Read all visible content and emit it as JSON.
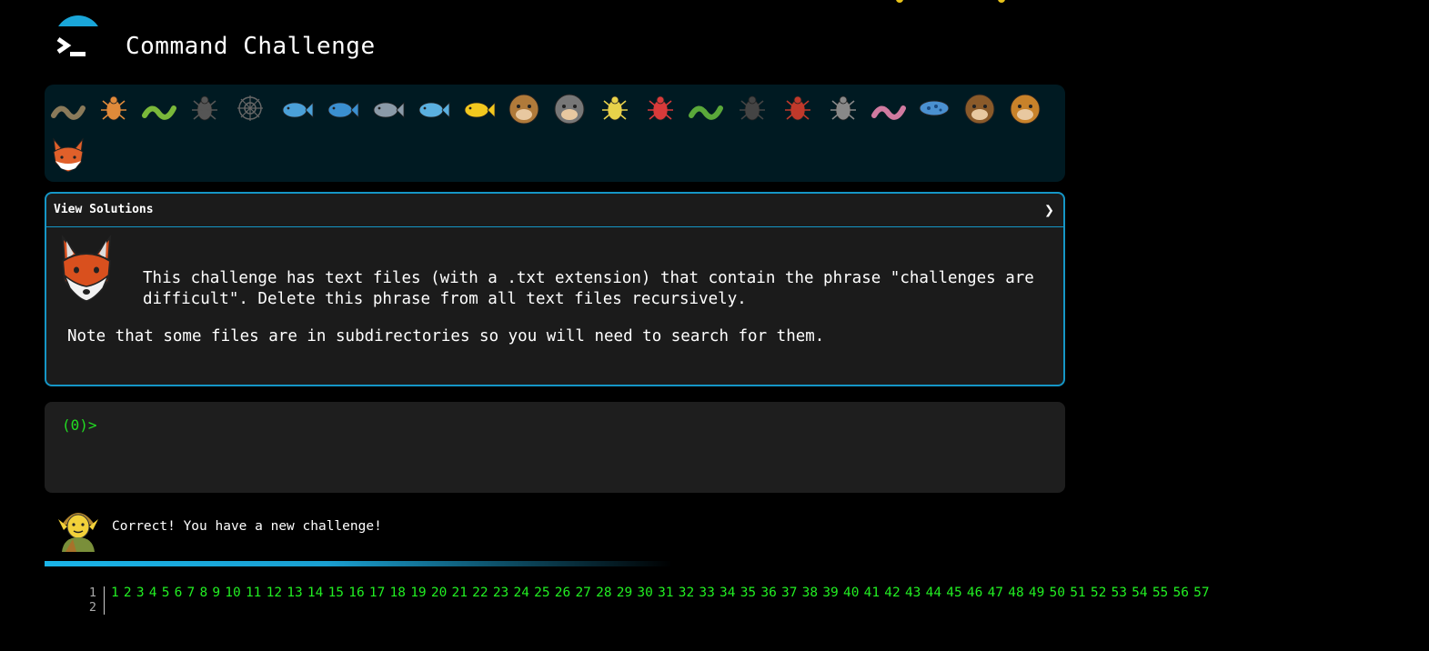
{
  "header": {
    "title": "Command Challenge",
    "logo_icon": "terminal-prompt-icon",
    "accent_color": "#1aa6d9"
  },
  "animals": [
    {
      "name": "snail-icon"
    },
    {
      "name": "butterfly-icon"
    },
    {
      "name": "caterpillar-icon"
    },
    {
      "name": "ant-icon"
    },
    {
      "name": "spider-web-icon"
    },
    {
      "name": "whale-icon"
    },
    {
      "name": "dolphin-icon"
    },
    {
      "name": "shark-icon"
    },
    {
      "name": "fish-icon"
    },
    {
      "name": "tropical-fish-icon"
    },
    {
      "name": "blowfish-icon"
    },
    {
      "name": "wolf-icon"
    },
    {
      "name": "bee-icon"
    },
    {
      "name": "ladybug-icon"
    },
    {
      "name": "cricket-icon"
    },
    {
      "name": "spider-icon"
    },
    {
      "name": "scorpion-icon"
    },
    {
      "name": "fly-icon"
    },
    {
      "name": "worm-icon"
    },
    {
      "name": "microbe-icon"
    },
    {
      "name": "monkey-icon"
    },
    {
      "name": "dog-icon"
    },
    {
      "name": "fox-icon"
    }
  ],
  "challenge": {
    "view_solutions": "View Solutions",
    "chevron": "❯",
    "description": "This challenge has text files (with a .txt extension) that contain the phrase \"challenges are difficult\". Delete this phrase from all text files recursively.",
    "note": "Note that some files are in subdirectories so you will need to search for them."
  },
  "terminal": {
    "prompt": "(0)>",
    "input_value": "",
    "prompt_color": "#22dd22"
  },
  "feedback": {
    "message": "Correct! You have a new challenge!"
  },
  "editor": {
    "line_numbers": [
      "1",
      "2"
    ],
    "levels": [
      "1",
      "2",
      "3",
      "4",
      "5",
      "6",
      "7",
      "8",
      "9",
      "10",
      "11",
      "12",
      "13",
      "14",
      "15",
      "16",
      "17",
      "18",
      "19",
      "20",
      "21",
      "22",
      "23",
      "24",
      "25",
      "26",
      "27",
      "28",
      "29",
      "30",
      "31",
      "32",
      "33",
      "34",
      "35",
      "36",
      "37",
      "38",
      "39",
      "40",
      "41",
      "42",
      "43",
      "44",
      "45",
      "46",
      "47",
      "48",
      "49",
      "50",
      "51",
      "52",
      "53",
      "54",
      "55",
      "56",
      "57"
    ],
    "level_color": "#22ee22"
  }
}
